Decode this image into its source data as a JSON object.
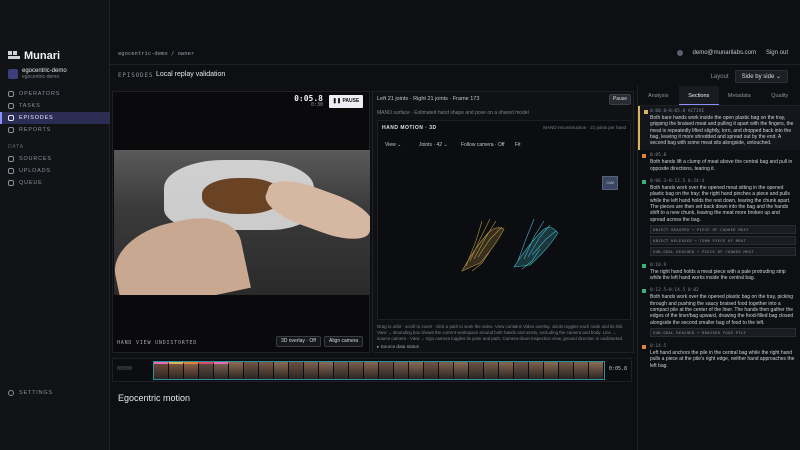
{
  "brand": {
    "name": "Munari"
  },
  "org": {
    "name": "egocentric-demo",
    "sub": "egocentric-demo"
  },
  "nav": {
    "items": [
      {
        "label": "OPERATORS",
        "active": false
      },
      {
        "label": "TASKS",
        "active": false
      },
      {
        "label": "EPISODES",
        "active": true
      },
      {
        "label": "REPORTS",
        "active": false
      }
    ],
    "data_section": "DATA",
    "data_items": [
      {
        "label": "SOURCES"
      },
      {
        "label": "UPLOADS"
      },
      {
        "label": "QUEUE"
      }
    ],
    "settings": "SETTINGS"
  },
  "topbar": {
    "breadcrumb": "egocentric-demo / owner",
    "email": "demo@munarilabs.com",
    "signout": "Sign out"
  },
  "header": {
    "episodes": "EPISODES",
    "title": "Local replay validation",
    "layout_label": "Layout",
    "layout_value": "Side by side"
  },
  "video": {
    "timecode": "0:05.8",
    "timecode_sub": "0:30",
    "pause": "PAUSE",
    "label": "HAND VIEW UNDISTORTED",
    "overlay_btn": "3D overlay · Off",
    "align_btn": "Align camera"
  },
  "hand": {
    "summary": "Left  21 joints · Right  21 joints · Frame 173",
    "surface_note": "MANO surface · Estimated hand shape and pose on a shared model",
    "pause": "Pause",
    "panel_title": "HAND MOTION · 3D",
    "panel_right": "MANO reconstruction · 21 joints per hand",
    "view": "View",
    "joints": "Joints · 42",
    "follow": "Follow camera · Off",
    "fit": "Fit",
    "cam_label": "CAM",
    "help": "Drag to orbit · scroll to zoom · click a path to seek the video. View contains Video overlay. Joints toggles each node and its link. View → Bounding box shows the current workspace around both hands and wrists, excluding the camera and body. Line → source camera · View → Ego camera toggles its pose and path. Camera-down inspection view, ground direction is undistorted.",
    "source_link": "▸ Source data status"
  },
  "right": {
    "tabs": [
      {
        "label": "Analysis",
        "active": false
      },
      {
        "label": "Sections",
        "active": true
      },
      {
        "label": "Metadata",
        "active": false
      },
      {
        "label": "Quality",
        "active": false
      }
    ],
    "sections": [
      {
        "color": "#d9b45a",
        "active": true,
        "time": "0:00.0–0:05.8  ACTIVE",
        "text": "Both bare hands work inside the open plastic bag on the tray, gripping the braised meat and pulling it apart with the fingers, the meat is repeatedly lifted slightly, torn, and dropped back into the bag, leaving it more shredded and spread out by the end. A second bag with some meat sits alongside, untouched.",
        "tags": []
      },
      {
        "color": "#e0843c",
        "active": false,
        "time": "0:05.8",
        "text": "Both hands lift a clump of meat above the central bag and pull in opposite directions, tearing it.",
        "tags": []
      },
      {
        "color": "#3fb07a",
        "active": false,
        "time": "0:06.3–0:12.5  0:24:4",
        "text": "Both hands work over the opened meat sitting in the opened plastic bag on the tray; the right hand pinches a piece and pulls while the left hand holds the rest down, tearing the chunk apart. The pieces are then set back down into the bag and the hands shift to a new chunk, leaving the meat more broken up and spread across the bag.",
        "tags": [
          "OBJECT GRASPED → PIECE OF COOKED MEAT",
          "OBJECT RELEASED → TORN PIECE OF MEAT",
          "SUB-GOAL REACHED → PIECE OF COOKED MEAT"
        ]
      },
      {
        "color": "#3fb07a",
        "active": false,
        "time": "0:10.9",
        "text": "The right hand holds a meat piece with a pale protruding strip while the left hand works inside the central bag.",
        "tags": []
      },
      {
        "color": "#3fb07a",
        "active": false,
        "time": "0:12.5–0:14.5  0:02",
        "text": "Both hands work over the opened plastic bag on the tray, picking through and pushing the saucy braised food together into a compact pile at the center of the liner. The hands then gather the edges of the liner/bag upward, drawing the food-filled bag closed alongside the second smaller bag of food to the left.",
        "tags": [
          "SUB-GOAL REACHED → BRAISED FOOD PILE"
        ]
      },
      {
        "color": "#e0843c",
        "active": false,
        "time": "0:14.5",
        "text": "Left hand anchors the pile in the central bag while the right hand pulls a piece at the pile's right edge, neither hand approaches the left bag.",
        "tags": []
      }
    ]
  },
  "timeline": {
    "label": "00000",
    "time": "0:05.8",
    "frames": [
      "#6a4a3a",
      "#7a5540",
      "#8a6048",
      "#5c4a42",
      "#7a6050",
      "#8c6a52",
      "#6e5446",
      "#7a5c4a",
      "#8a6a54",
      "#6a5044",
      "#7e6250",
      "#8a6a56",
      "#705648",
      "#7a5e4c",
      "#866850",
      "#6a5246",
      "#7c604e",
      "#886a54",
      "#705446",
      "#7e624e",
      "#8a6c56",
      "#6c5246",
      "#7a5e4c",
      "#866852",
      "#6e5448",
      "#7c604c",
      "#8a6a54",
      "#705646",
      "#7e624e",
      "#8a6c56"
    ],
    "markers": [
      "#e36fb7",
      "#d9b45a",
      "#e0843c",
      "#d94c6a",
      "#e36fb7"
    ]
  },
  "bottom": {
    "title": "Egocentric motion"
  }
}
